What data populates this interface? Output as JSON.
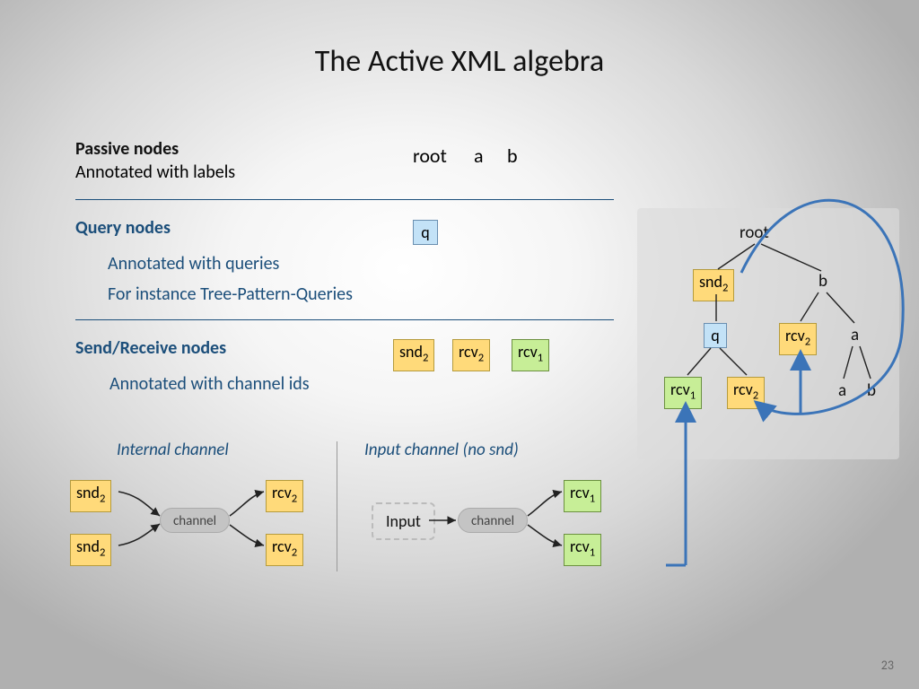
{
  "title": "The Active XML algebra",
  "passive": {
    "heading": "Passive nodes",
    "subtext": "Annotated with labels",
    "examples": [
      "root",
      "a",
      "b"
    ]
  },
  "query": {
    "heading": "Query nodes",
    "line1": "Annotated with queries",
    "line2": "For instance Tree-Pattern-Queries",
    "node": "q"
  },
  "sendrecv": {
    "heading": "Send/Receive nodes",
    "subtext": "Annotated with channel ids",
    "snd": "snd",
    "rcv": "rcv"
  },
  "channels": {
    "internal_label": "Internal channel",
    "input_label": "Input channel (no snd)",
    "channel_word": "channel",
    "input_word": "Input"
  },
  "tree": {
    "root": "root",
    "snd": "snd",
    "b": "b",
    "q": "q",
    "rcv": "rcv",
    "a": "a"
  },
  "pagenum": "23"
}
